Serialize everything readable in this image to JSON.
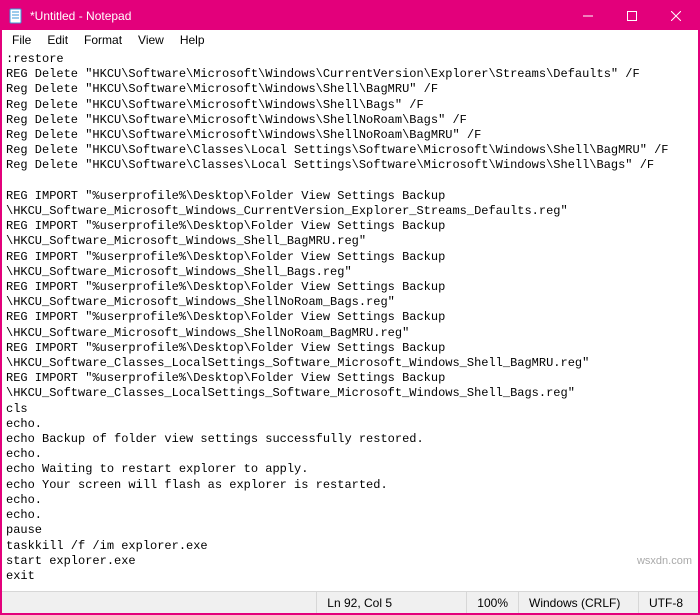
{
  "window": {
    "title": "*Untitled - Notepad",
    "icon_name": "notepad-icon"
  },
  "titlebar_buttons": {
    "minimize": "minimize-button",
    "maximize": "maximize-button",
    "close": "close-button"
  },
  "menubar": {
    "items": [
      {
        "label": "File"
      },
      {
        "label": "Edit"
      },
      {
        "label": "Format"
      },
      {
        "label": "View"
      },
      {
        "label": "Help"
      }
    ]
  },
  "editor": {
    "content": ":restore\nREG Delete \"HKCU\\Software\\Microsoft\\Windows\\CurrentVersion\\Explorer\\Streams\\Defaults\" /F\nReg Delete \"HKCU\\Software\\Microsoft\\Windows\\Shell\\BagMRU\" /F\nReg Delete \"HKCU\\Software\\Microsoft\\Windows\\Shell\\Bags\" /F\nReg Delete \"HKCU\\Software\\Microsoft\\Windows\\ShellNoRoam\\Bags\" /F\nReg Delete \"HKCU\\Software\\Microsoft\\Windows\\ShellNoRoam\\BagMRU\" /F\nReg Delete \"HKCU\\Software\\Classes\\Local Settings\\Software\\Microsoft\\Windows\\Shell\\BagMRU\" /F\nReg Delete \"HKCU\\Software\\Classes\\Local Settings\\Software\\Microsoft\\Windows\\Shell\\Bags\" /F\n\nREG IMPORT \"%userprofile%\\Desktop\\Folder View Settings Backup\n\\HKCU_Software_Microsoft_Windows_CurrentVersion_Explorer_Streams_Defaults.reg\"\nREG IMPORT \"%userprofile%\\Desktop\\Folder View Settings Backup\n\\HKCU_Software_Microsoft_Windows_Shell_BagMRU.reg\"\nREG IMPORT \"%userprofile%\\Desktop\\Folder View Settings Backup\n\\HKCU_Software_Microsoft_Windows_Shell_Bags.reg\"\nREG IMPORT \"%userprofile%\\Desktop\\Folder View Settings Backup\n\\HKCU_Software_Microsoft_Windows_ShellNoRoam_Bags.reg\"\nREG IMPORT \"%userprofile%\\Desktop\\Folder View Settings Backup\n\\HKCU_Software_Microsoft_Windows_ShellNoRoam_BagMRU.reg\"\nREG IMPORT \"%userprofile%\\Desktop\\Folder View Settings Backup\n\\HKCU_Software_Classes_LocalSettings_Software_Microsoft_Windows_Shell_BagMRU.reg\"\nREG IMPORT \"%userprofile%\\Desktop\\Folder View Settings Backup\n\\HKCU_Software_Classes_LocalSettings_Software_Microsoft_Windows_Shell_Bags.reg\"\ncls\necho.\necho Backup of folder view settings successfully restored.\necho.\necho Waiting to restart explorer to apply.\necho Your screen will flash as explorer is restarted.\necho.\necho.\npause\ntaskkill /f /im explorer.exe\nstart explorer.exe\nexit"
  },
  "statusbar": {
    "position": "Ln 92, Col 5",
    "zoom": "100%",
    "line_ending": "Windows (CRLF)",
    "encoding": "UTF-8"
  },
  "watermark": "wsxdn.com",
  "colors": {
    "accent": "#e3007b"
  }
}
